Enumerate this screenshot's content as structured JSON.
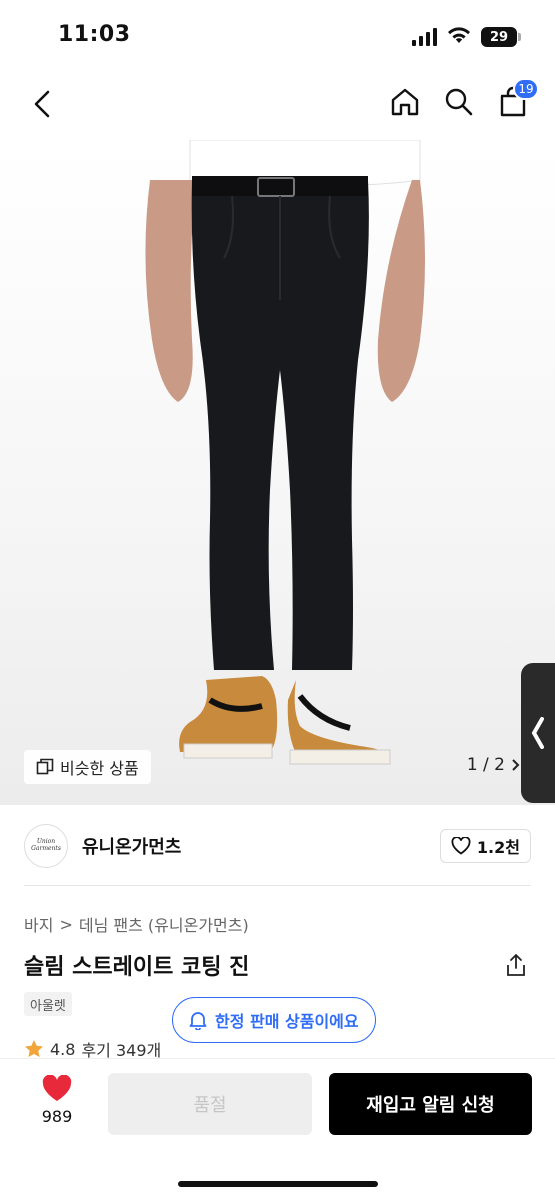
{
  "status_bar": {
    "time": "11:03",
    "battery": "29"
  },
  "nav": {
    "cart_count": "19"
  },
  "hero": {
    "similar_label": "비슷한 상품",
    "page_indicator": "1 / 2"
  },
  "brand": {
    "logo_text": "Union Garments",
    "name": "유니온가먼츠",
    "like_count": "1.2천"
  },
  "breadcrumb": {
    "level1": "바지",
    "separator": ">",
    "level2": "데님 팬츠 (유니온가먼츠)"
  },
  "product": {
    "title": "슬림 스트레이트 코팅 진",
    "tag": "아울렛",
    "limited_notice": "한정 판매 상품이에요",
    "rating": "4.8",
    "review_text": "후기 349개"
  },
  "bottom_bar": {
    "wish_count": "989",
    "soldout_label": "품절",
    "restock_label": "재입고 알림 신청"
  },
  "colors": {
    "accent": "#2f6df6",
    "heart": "#e8293b",
    "primary_button": "#000000"
  }
}
